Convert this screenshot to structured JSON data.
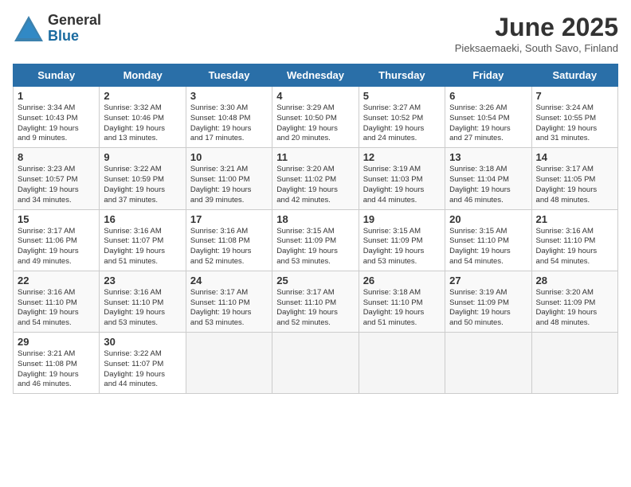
{
  "logo": {
    "general": "General",
    "blue": "Blue"
  },
  "title": "June 2025",
  "subtitle": "Pieksaemaeki, South Savo, Finland",
  "days_of_week": [
    "Sunday",
    "Monday",
    "Tuesday",
    "Wednesday",
    "Thursday",
    "Friday",
    "Saturday"
  ],
  "weeks": [
    [
      {
        "day": "1",
        "info": "Sunrise: 3:34 AM\nSunset: 10:43 PM\nDaylight: 19 hours\nand 9 minutes."
      },
      {
        "day": "2",
        "info": "Sunrise: 3:32 AM\nSunset: 10:46 PM\nDaylight: 19 hours\nand 13 minutes."
      },
      {
        "day": "3",
        "info": "Sunrise: 3:30 AM\nSunset: 10:48 PM\nDaylight: 19 hours\nand 17 minutes."
      },
      {
        "day": "4",
        "info": "Sunrise: 3:29 AM\nSunset: 10:50 PM\nDaylight: 19 hours\nand 20 minutes."
      },
      {
        "day": "5",
        "info": "Sunrise: 3:27 AM\nSunset: 10:52 PM\nDaylight: 19 hours\nand 24 minutes."
      },
      {
        "day": "6",
        "info": "Sunrise: 3:26 AM\nSunset: 10:54 PM\nDaylight: 19 hours\nand 27 minutes."
      },
      {
        "day": "7",
        "info": "Sunrise: 3:24 AM\nSunset: 10:55 PM\nDaylight: 19 hours\nand 31 minutes."
      }
    ],
    [
      {
        "day": "8",
        "info": "Sunrise: 3:23 AM\nSunset: 10:57 PM\nDaylight: 19 hours\nand 34 minutes."
      },
      {
        "day": "9",
        "info": "Sunrise: 3:22 AM\nSunset: 10:59 PM\nDaylight: 19 hours\nand 37 minutes."
      },
      {
        "day": "10",
        "info": "Sunrise: 3:21 AM\nSunset: 11:00 PM\nDaylight: 19 hours\nand 39 minutes."
      },
      {
        "day": "11",
        "info": "Sunrise: 3:20 AM\nSunset: 11:02 PM\nDaylight: 19 hours\nand 42 minutes."
      },
      {
        "day": "12",
        "info": "Sunrise: 3:19 AM\nSunset: 11:03 PM\nDaylight: 19 hours\nand 44 minutes."
      },
      {
        "day": "13",
        "info": "Sunrise: 3:18 AM\nSunset: 11:04 PM\nDaylight: 19 hours\nand 46 minutes."
      },
      {
        "day": "14",
        "info": "Sunrise: 3:17 AM\nSunset: 11:05 PM\nDaylight: 19 hours\nand 48 minutes."
      }
    ],
    [
      {
        "day": "15",
        "info": "Sunrise: 3:17 AM\nSunset: 11:06 PM\nDaylight: 19 hours\nand 49 minutes."
      },
      {
        "day": "16",
        "info": "Sunrise: 3:16 AM\nSunset: 11:07 PM\nDaylight: 19 hours\nand 51 minutes."
      },
      {
        "day": "17",
        "info": "Sunrise: 3:16 AM\nSunset: 11:08 PM\nDaylight: 19 hours\nand 52 minutes."
      },
      {
        "day": "18",
        "info": "Sunrise: 3:15 AM\nSunset: 11:09 PM\nDaylight: 19 hours\nand 53 minutes."
      },
      {
        "day": "19",
        "info": "Sunrise: 3:15 AM\nSunset: 11:09 PM\nDaylight: 19 hours\nand 53 minutes."
      },
      {
        "day": "20",
        "info": "Sunrise: 3:15 AM\nSunset: 11:10 PM\nDaylight: 19 hours\nand 54 minutes."
      },
      {
        "day": "21",
        "info": "Sunrise: 3:16 AM\nSunset: 11:10 PM\nDaylight: 19 hours\nand 54 minutes."
      }
    ],
    [
      {
        "day": "22",
        "info": "Sunrise: 3:16 AM\nSunset: 11:10 PM\nDaylight: 19 hours\nand 54 minutes."
      },
      {
        "day": "23",
        "info": "Sunrise: 3:16 AM\nSunset: 11:10 PM\nDaylight: 19 hours\nand 53 minutes."
      },
      {
        "day": "24",
        "info": "Sunrise: 3:17 AM\nSunset: 11:10 PM\nDaylight: 19 hours\nand 53 minutes."
      },
      {
        "day": "25",
        "info": "Sunrise: 3:17 AM\nSunset: 11:10 PM\nDaylight: 19 hours\nand 52 minutes."
      },
      {
        "day": "26",
        "info": "Sunrise: 3:18 AM\nSunset: 11:10 PM\nDaylight: 19 hours\nand 51 minutes."
      },
      {
        "day": "27",
        "info": "Sunrise: 3:19 AM\nSunset: 11:09 PM\nDaylight: 19 hours\nand 50 minutes."
      },
      {
        "day": "28",
        "info": "Sunrise: 3:20 AM\nSunset: 11:09 PM\nDaylight: 19 hours\nand 48 minutes."
      }
    ],
    [
      {
        "day": "29",
        "info": "Sunrise: 3:21 AM\nSunset: 11:08 PM\nDaylight: 19 hours\nand 46 minutes."
      },
      {
        "day": "30",
        "info": "Sunrise: 3:22 AM\nSunset: 11:07 PM\nDaylight: 19 hours\nand 44 minutes."
      },
      {
        "day": "",
        "info": ""
      },
      {
        "day": "",
        "info": ""
      },
      {
        "day": "",
        "info": ""
      },
      {
        "day": "",
        "info": ""
      },
      {
        "day": "",
        "info": ""
      }
    ]
  ]
}
